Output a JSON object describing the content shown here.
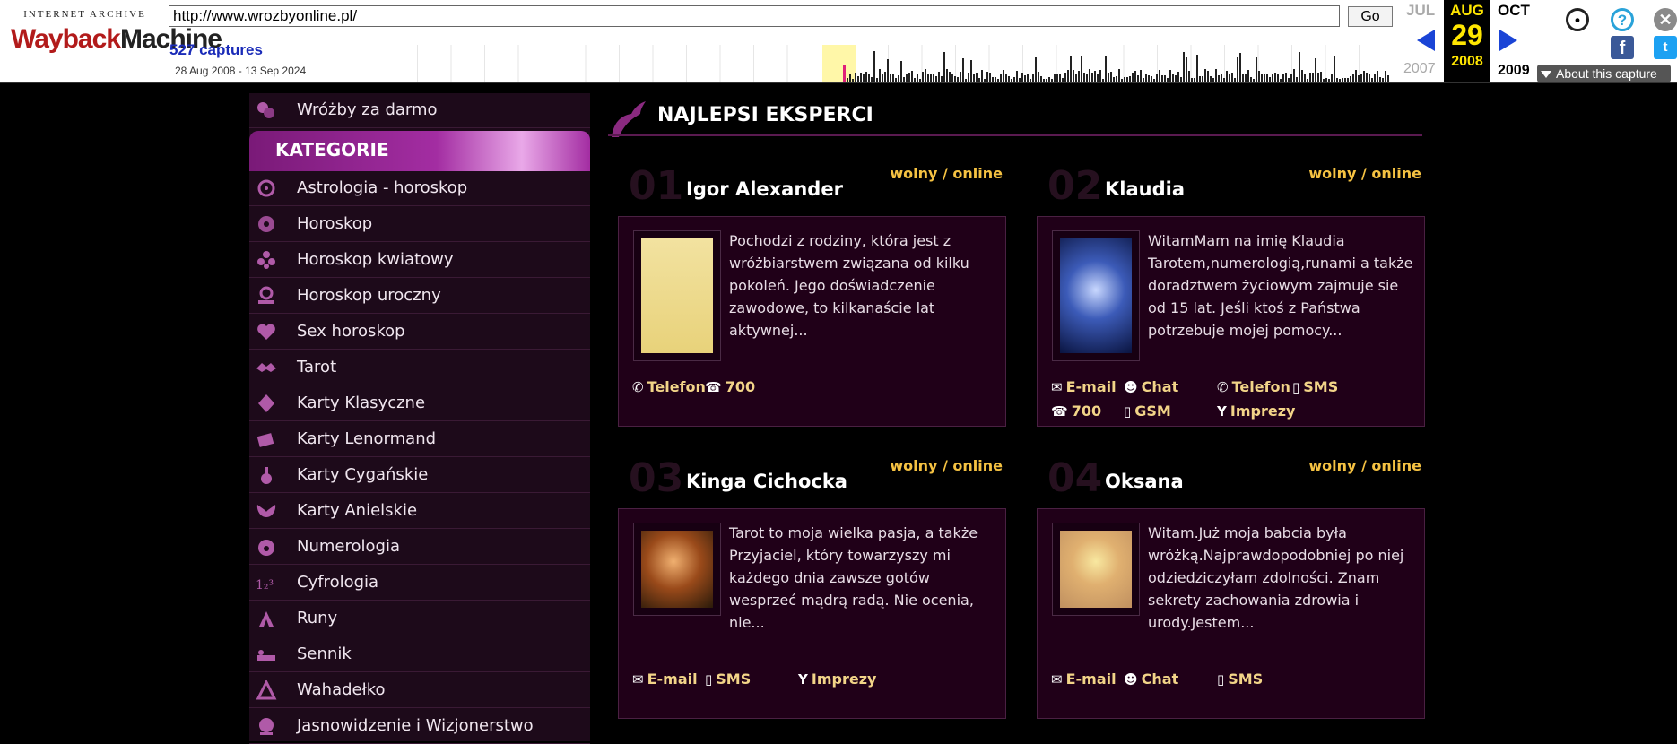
{
  "wayback": {
    "logo_top": "INTERNET ARCHIVE",
    "logo_wayback": "Wayback",
    "logo_machine": "Machine",
    "url": "http://www.wrozbyonline.pl/",
    "go_label": "Go",
    "captures": "527 captures",
    "date_range": "28 Aug 2008 - 13 Sep 2024",
    "prev_month": "JUL",
    "cur_month": "AUG",
    "cur_day": "29",
    "cur_year": "2008",
    "next_month": "OCT",
    "prev_year": "2007",
    "next_year": "2009",
    "about_label": "About this capture"
  },
  "sidebar": {
    "top_item": "Wróżby za darmo",
    "category_header": "KATEGORIE",
    "items": [
      {
        "label": "Astrologia - horoskop",
        "icon": "zodiac-wheel-icon"
      },
      {
        "label": "Horoskop",
        "icon": "zodiac-icon"
      },
      {
        "label": "Horoskop kwiatowy",
        "icon": "flower-icon"
      },
      {
        "label": "Horoskop uroczny",
        "icon": "person-icon"
      },
      {
        "label": "Sex horoskop",
        "icon": "hearts-icon"
      },
      {
        "label": "Tarot",
        "icon": "tarot-icon"
      },
      {
        "label": "Karty Klasyczne",
        "icon": "diamond-icon"
      },
      {
        "label": "Karty Lenormand",
        "icon": "cards-icon"
      },
      {
        "label": "Karty Cygańskie",
        "icon": "gypsy-icon"
      },
      {
        "label": "Karty Anielskie",
        "icon": "angel-wings-icon"
      },
      {
        "label": "Numerologia",
        "icon": "numerology-icon"
      },
      {
        "label": "Cyfrologia",
        "icon": "digits-icon"
      },
      {
        "label": "Runy",
        "icon": "rune-icon"
      },
      {
        "label": "Sennik",
        "icon": "sleep-icon"
      },
      {
        "label": "Wahadełko",
        "icon": "pendulum-icon"
      },
      {
        "label": "Jasnowidzenie i Wizjonerstwo",
        "icon": "crystal-ball-icon"
      }
    ]
  },
  "main": {
    "title": "NAJLEPSI EKSPERCI",
    "experts": [
      {
        "num": "01",
        "name": "Igor Alexander",
        "status": "wolny / online",
        "desc": "Pochodzi z rodziny, która jest z wróżbiarstwem związana od kilku pokoleń. Jego doświadczenie zawodowe, to kilkanaście lat aktywnej...",
        "photo": "tarot-card-key",
        "services": [
          {
            "label": "Telefon",
            "icon": "phone-icon"
          },
          {
            "label": "700",
            "icon": "telephone-icon"
          }
        ]
      },
      {
        "num": "02",
        "name": "Klaudia",
        "status": "wolny / online",
        "desc": "WitamMam na imię Klaudia Tarotem,numerologią,runami a także doradztwem życiowym zajmuje sie od 15 lat. Jeśli ktoś z Państwa potrzebuje mojej pomocy...",
        "photo": "blue-fairy",
        "services": [
          {
            "label": "E-mail",
            "icon": "envelope-icon"
          },
          {
            "label": "Chat",
            "icon": "chat-icon"
          },
          {
            "label": "Telefon",
            "icon": "phone-icon"
          },
          {
            "label": "SMS",
            "icon": "mobile-icon"
          },
          {
            "label": "700",
            "icon": "telephone-icon"
          },
          {
            "label": "GSM",
            "icon": "mobile-icon"
          },
          {
            "label": "Imprezy",
            "icon": "glass-icon"
          }
        ]
      },
      {
        "num": "03",
        "name": "Kinga Cichocka",
        "status": "wolny / online",
        "desc": "Tarot to moja wielka pasja, a także Przyjaciel, który towarzyszy mi każdego dnia zawsze gotów wesprzeć mądrą radą. Nie ocenia, nie...",
        "photo": "woman-painting",
        "services": [
          {
            "label": "E-mail",
            "icon": "envelope-icon"
          },
          {
            "label": "SMS",
            "icon": "mobile-icon"
          },
          {
            "label": "Imprezy",
            "icon": "glass-icon"
          }
        ]
      },
      {
        "num": "04",
        "name": "Oksana",
        "status": "wolny / online",
        "desc": "Witam.Już moja babcia była wróżką.Najprawdopodobniej po niej odziedziczyłam zdolności. Znam sekrety zachowania zdrowia i urody.Jestem...",
        "photo": "blonde-woman",
        "services": [
          {
            "label": "E-mail",
            "icon": "envelope-icon"
          },
          {
            "label": "Chat",
            "icon": "chat-icon"
          },
          {
            "label": "SMS",
            "icon": "mobile-icon"
          }
        ]
      }
    ]
  }
}
